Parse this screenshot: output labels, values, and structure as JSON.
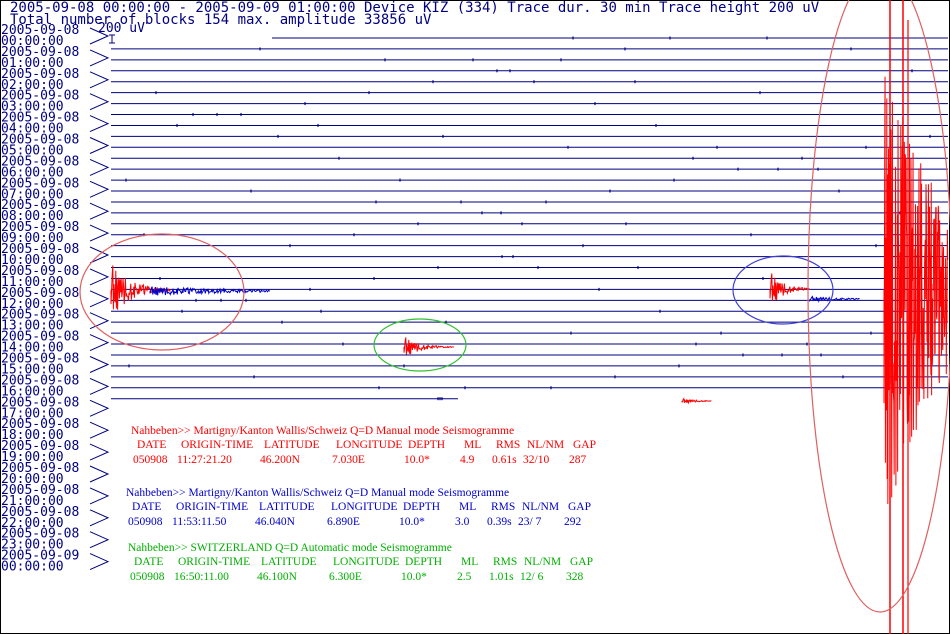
{
  "header": {
    "line1": "2005-09-08 00:00:00 - 2005-09-09 01:00:00  Device  KIZ (334)  Trace dur. 30 min  Trace height 200 uV",
    "line2": "Total number of blocks 154 max. amplitude 33856 uV",
    "scale_label": "200 uV"
  },
  "colors": {
    "trace": "#000080",
    "event_red": "#ff0000",
    "event_blue": "#0000cc",
    "event_green": "#00c000",
    "text_axis": "#000080"
  },
  "chart_data": {
    "type": "line",
    "title": "2005-09-08 00:00:00 - 2005-09-09 01:00:00  Device  KIZ (334)  Trace dur. 30 min  Trace height 200 uV",
    "trace_duration_min": 30,
    "trace_height_uV": 200,
    "max_amplitude_uV": 33856,
    "total_blocks": 154,
    "row_labels": [
      {
        "date": "2005-09-08",
        "time": "00:00:00"
      },
      {
        "date": "2005-09-08",
        "time": "01:00:00"
      },
      {
        "date": "2005-09-08",
        "time": "02:00:00"
      },
      {
        "date": "2005-09-08",
        "time": "03:00:00"
      },
      {
        "date": "2005-09-08",
        "time": "04:00:00"
      },
      {
        "date": "2005-09-08",
        "time": "05:00:00"
      },
      {
        "date": "2005-09-08",
        "time": "06:00:00"
      },
      {
        "date": "2005-09-08",
        "time": "07:00:00"
      },
      {
        "date": "2005-09-08",
        "time": "08:00:00"
      },
      {
        "date": "2005-09-08",
        "time": "09:00:00"
      },
      {
        "date": "2005-09-08",
        "time": "10:00:00"
      },
      {
        "date": "2005-09-08",
        "time": "11:00:00"
      },
      {
        "date": "2005-09-08",
        "time": "12:00:00"
      },
      {
        "date": "2005-09-08",
        "time": "13:00:00"
      },
      {
        "date": "2005-09-08",
        "time": "14:00:00"
      },
      {
        "date": "2005-09-08",
        "time": "15:00:00"
      },
      {
        "date": "2005-09-08",
        "time": "16:00:00"
      },
      {
        "date": "2005-09-08",
        "time": "17:00:00"
      },
      {
        "date": "2005-09-08",
        "time": "18:00:00"
      },
      {
        "date": "2005-09-08",
        "time": "19:00:00"
      },
      {
        "date": "2005-09-08",
        "time": "20:00:00"
      },
      {
        "date": "2005-09-08",
        "time": "21:00:00"
      },
      {
        "date": "2005-09-08",
        "time": "22:00:00"
      },
      {
        "date": "2005-09-08",
        "time": "23:00:00"
      },
      {
        "date": "2005-09-09",
        "time": "00:00:00"
      }
    ],
    "events_marked": [
      {
        "color": "red",
        "origin_time": "11:27:21.20"
      },
      {
        "color": "blue",
        "origin_time": "11:53:11.50"
      },
      {
        "color": "green",
        "origin_time": "16:50:11.00"
      }
    ]
  },
  "bulletins": [
    {
      "color": "#ff0000",
      "header": "Nahbeben>> Martigny/Kanton Wallis/Schweiz  Q=D   Manual mode    Seismogramme",
      "columns": [
        "DATE",
        "ORIGIN-TIME",
        "LATITUDE",
        "LONGITUDE",
        "DEPTH",
        "ML",
        "RMS",
        "NL/NM",
        "GAP"
      ],
      "values": [
        "050908",
        "11:27:21.20",
        "46.200N",
        "7.030E",
        "10.0*",
        "4.9",
        "0.61s",
        "32/10",
        "287"
      ]
    },
    {
      "color": "#0000cc",
      "header": "Nahbeben>> Martigny/Kanton Wallis/Schweiz  Q=D   Manual mode    Seismogramme",
      "columns": [
        "DATE",
        "ORIGIN-TIME",
        "LATITUDE",
        "LONGITUDE",
        "DEPTH",
        "ML",
        "RMS",
        "NL/NM",
        "GAP"
      ],
      "values": [
        "050908",
        "11:53:11.50",
        "46.040N",
        "6.890E",
        "10.0*",
        "3.0",
        "0.39s",
        "23/ 7",
        "292"
      ]
    },
    {
      "color": "#00b000",
      "header": "Nahbeben>> SWITZERLAND  Q=D   Automatic mode    Seismogramme",
      "columns": [
        "DATE",
        "ORIGIN-TIME",
        "LATITUDE",
        "LONGITUDE",
        "DEPTH",
        "ML",
        "RMS",
        "NL/NM",
        "GAP"
      ],
      "values": [
        "050908",
        "16:50:11.00",
        "46.100N",
        "6.300E",
        "10.0*",
        "2.5",
        "1.01s",
        "12/ 6",
        "328"
      ]
    }
  ]
}
